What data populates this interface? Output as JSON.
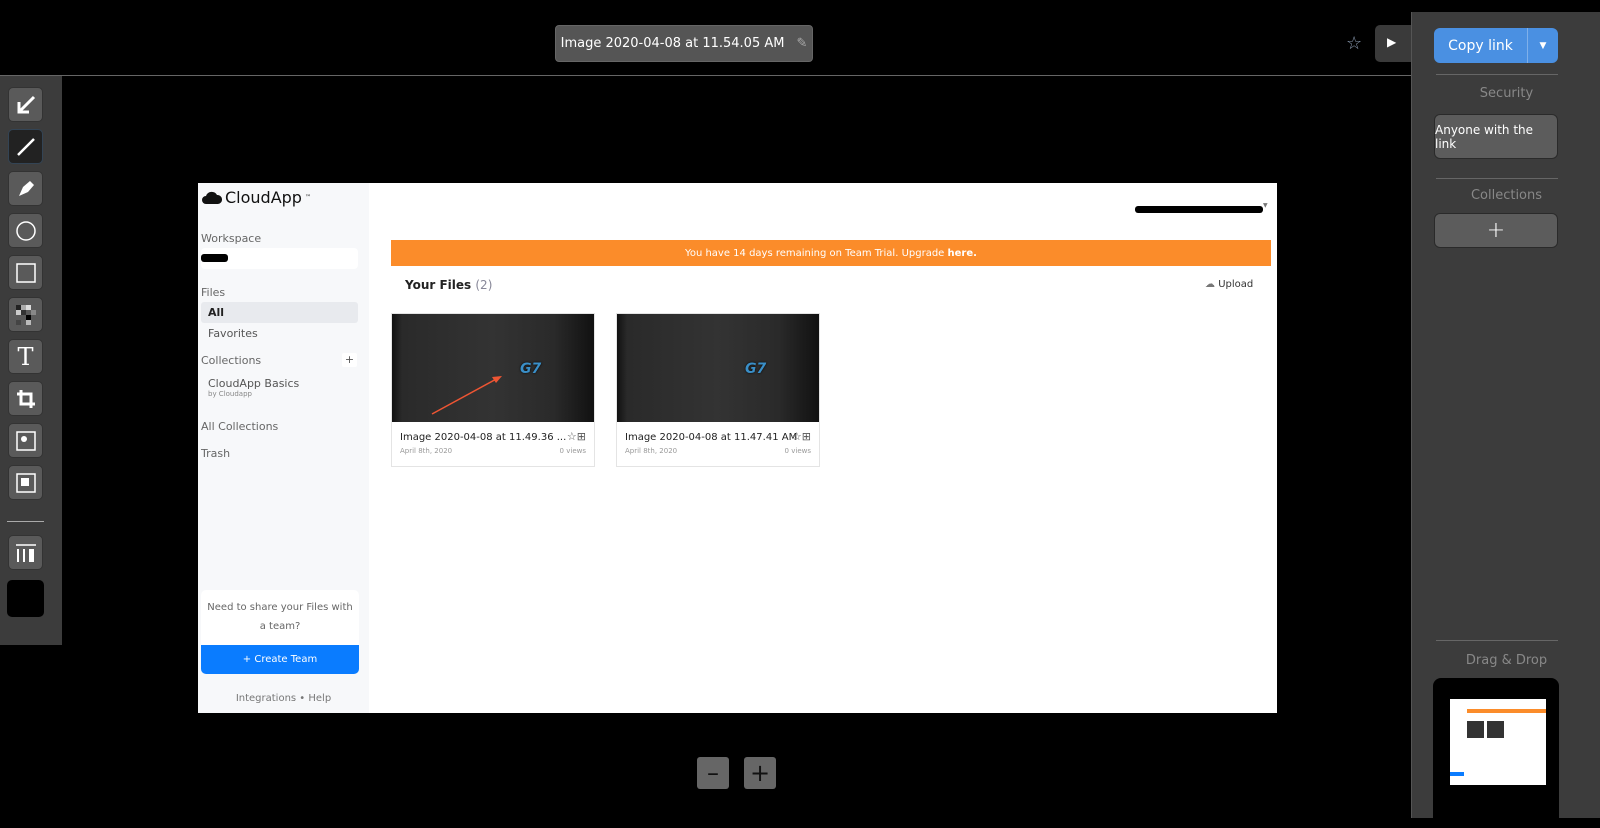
{
  "header": {
    "title": "Image 2020-04-08 at 11.54.05 AM",
    "edit_icon": "pencil-icon",
    "favorite_icon": "star-icon",
    "toggle_icon": "play-icon"
  },
  "toolbar": {
    "tools": [
      "arrow-tool",
      "line-tool",
      "highlighter-tool",
      "ellipse-tool",
      "rectangle-tool",
      "pixelate-tool",
      "text-tool",
      "crop-tool",
      "spotlight-tool",
      "focus-tool",
      "resize-tool"
    ],
    "active": "line-tool",
    "color": "#000000"
  },
  "right_panel": {
    "copy_link": "Copy link",
    "security_label": "Security",
    "security_value": "Anyone with the link",
    "collections_label": "Collections",
    "add_collection": "+",
    "drag_drop_label": "Drag & Drop"
  },
  "zoom": {
    "out": "–",
    "in": "+"
  },
  "app": {
    "logo": "CloudApp",
    "logo_tm": "™",
    "workspace_label": "Workspace",
    "files_label": "Files",
    "files_items": [
      "All",
      "Favorites"
    ],
    "collections_label": "Collections",
    "collection": {
      "name": "CloudApp Basics",
      "by": "by Cloudapp"
    },
    "all_collections": "All Collections",
    "trash": "Trash",
    "promo_text": "Need to share your Files with a team?",
    "create_team": "+ Create Team",
    "footer": "Integrations • Help",
    "banner_text": "You have 14 days remaining on Team Trial. Upgrade ",
    "banner_link": "here.",
    "banner_color": "#fb8c2a",
    "your_files": "Your Files",
    "files_count": "(2)",
    "upload": "Upload",
    "files": [
      {
        "name": "Image 2020-04-08 at 11.49.36 ...",
        "date": "April 8th, 2020",
        "views": "0 views"
      },
      {
        "name": "Image 2020-04-08 at 11.47.41 AM",
        "date": "April 8th, 2020",
        "views": "0 views"
      }
    ]
  }
}
